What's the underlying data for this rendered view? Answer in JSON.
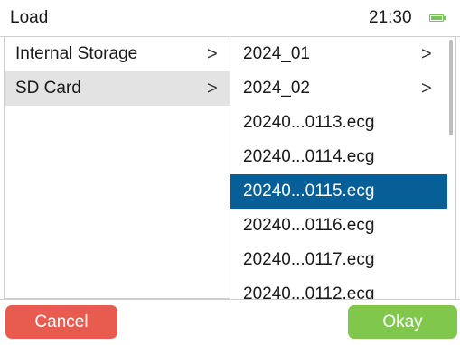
{
  "header": {
    "title": "Load",
    "time": "21:30",
    "battery_icon": "battery-icon",
    "battery_color": "#7ac25a"
  },
  "left_panel": {
    "items": [
      {
        "label": "Internal Storage",
        "chevron": ">"
      },
      {
        "label": "SD Card",
        "chevron": ">",
        "selected": true
      }
    ]
  },
  "right_panel": {
    "items": [
      {
        "label": "2024_01",
        "chevron": ">"
      },
      {
        "label": "2024_02",
        "chevron": ">"
      },
      {
        "label": "20240...0113.ecg"
      },
      {
        "label": "20240...0114.ecg"
      },
      {
        "label": "20240...0115.ecg",
        "selected": true
      },
      {
        "label": "20240...0116.ecg"
      },
      {
        "label": "20240...0117.ecg"
      },
      {
        "label": "20240...0112.ecg"
      }
    ]
  },
  "footer": {
    "cancel_label": "Cancel",
    "okay_label": "Okay",
    "cancel_color": "#e85c50",
    "okay_color": "#7fc84c"
  },
  "colors": {
    "selection_blue": "#075f97",
    "selection_grey": "#e3e3e3"
  }
}
